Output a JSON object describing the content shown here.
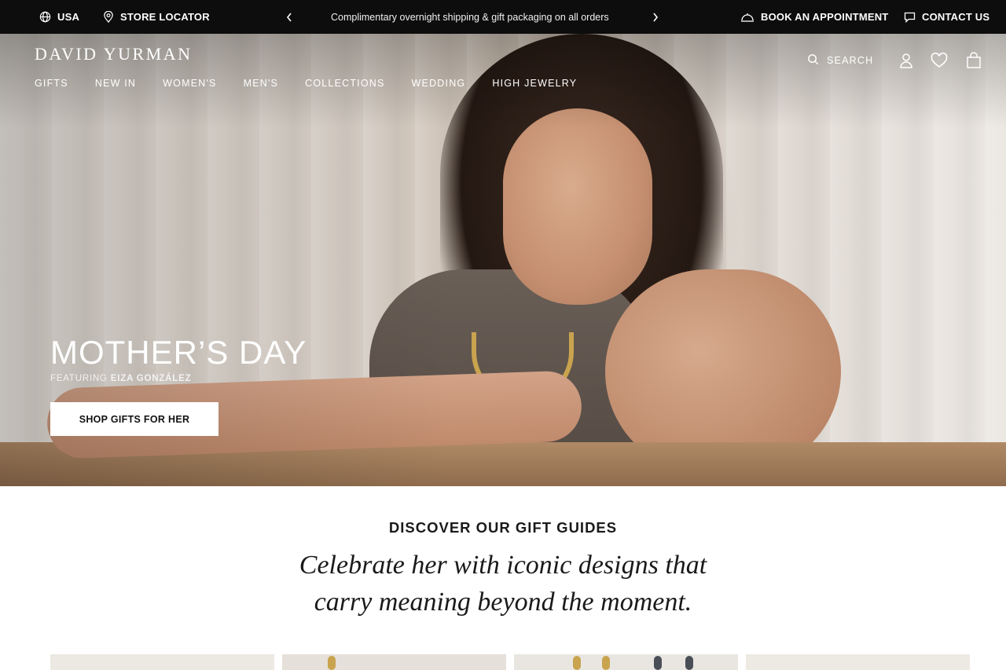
{
  "topbar": {
    "country": "USA",
    "store_locator": "STORE LOCATOR",
    "promo": "Complimentary overnight shipping & gift packaging on all orders",
    "book_appointment": "BOOK AN APPOINTMENT",
    "contact_us": "CONTACT US"
  },
  "header": {
    "logo": "DAVID YURMAN",
    "nav": [
      "GIFTS",
      "NEW IN",
      "WOMEN'S",
      "MEN'S",
      "COLLECTIONS",
      "WEDDING",
      "HIGH JEWELRY"
    ],
    "search_label": "SEARCH"
  },
  "hero": {
    "title": "MOTHER’S DAY",
    "subtitle_prefix": "FEATURING",
    "subtitle_name": "EIZA GONZÁLEZ",
    "cta": "SHOP GIFTS FOR HER"
  },
  "gift_guides": {
    "heading": "DISCOVER OUR GIFT GUIDES",
    "tagline": "Celebrate her with iconic designs that carry meaning beyond the moment."
  },
  "colors": {
    "topbar_bg": "#0d0d0d",
    "accent_gold": "#c9a34e",
    "text": "#1a1a1a"
  }
}
